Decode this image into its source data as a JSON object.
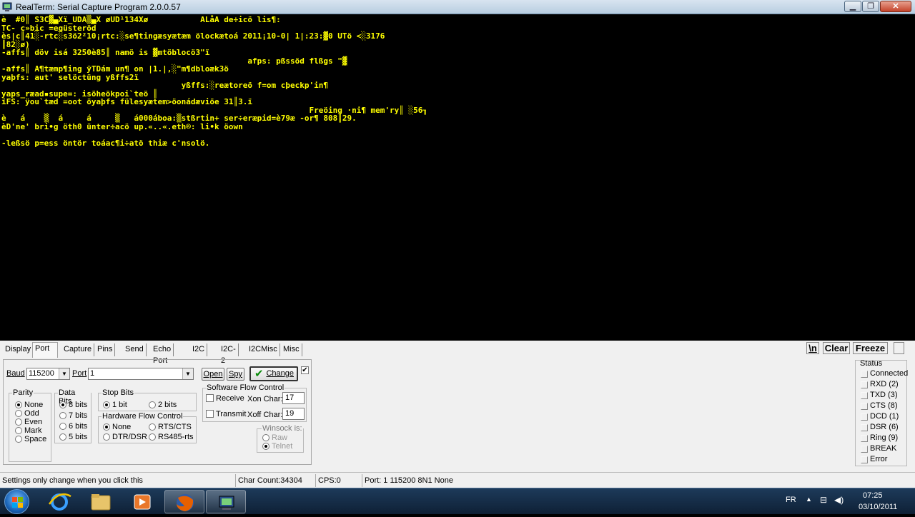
{
  "window": {
    "title": "RealTerm: Serial Capture Program 2.0.0.57"
  },
  "terminal": {
    "lines": [
      "è  #0║ S3C▓▄Xï_UDA▒▄X øUD¹134Xø           ALåA de÷icö lis¶:",
      "TC- c»bic =egüsteröd",
      "ès|c║41░-rtc░s3ö2²10¡rtc:░se¶tingæsyætæm ölockætoá 2011¡10-0| 1|:23:▓0 UTö <░3176",
      "║82░ø)",
      "-affs║ döv isá 3250è85║ namö is ▓mtöblocö3\"ï",
      "                                                    afps: pßssöd flßgs \"▓",
      "-affs║ A¶tæmp¶ing ÿTDám un¶ on |1.|,░\"m¶dbloæk3ö",
      "yaþfs: aut' selöctüng yßffs2ï",
      "                                      yßffs:░reætoreö f=om cþeckp'in¶",
      "yaps_ræad▪supe=: isöheökpoi`teö ║",
      "ïFS: ÿou`tæd =oot öyaþfs fülesyætem>öonádæviöe 31║3.ï",
      "                                                                 Freöing ·ni¶ mem'ry║ ░56╖",
      "è   á    ▒  á     á     ▒   á000áboa:▒stßrtin+ ser÷eræpid=è79æ -or¶ 808║29.",
      "èD'ne' bri•g öth0 ünter÷acö up.«..«.eth®: li•k öown",
      "",
      "-leßsö p=ess öntör toáac¶i÷atö thiæ c'nsolö."
    ]
  },
  "tabs": [
    "Display",
    "Port",
    "Capture",
    "Pins",
    "Send",
    "Echo Port",
    "I2C",
    "I2C-2",
    "I2CMisc",
    "Misc"
  ],
  "top_buttons": {
    "newline": "\\n",
    "clear": "Clear",
    "freeze": "Freeze"
  },
  "port": {
    "baud_label": "Baud",
    "baud_value": "115200",
    "port_label": "Port",
    "port_value": "1",
    "open": "Open",
    "spy": "Spy",
    "change": "Change",
    "parity": {
      "title": "Parity",
      "options": [
        "None",
        "Odd",
        "Even",
        "Mark",
        "Space"
      ],
      "selected": "None"
    },
    "data_bits": {
      "title": "Data Bits",
      "options": [
        "8 bits",
        "7 bits",
        "6 bits",
        "5 bits"
      ],
      "selected": "8 bits"
    },
    "stop_bits": {
      "title": "Stop Bits",
      "options": [
        "1 bit",
        "2 bits"
      ],
      "selected": "1 bit"
    },
    "hw_flow": {
      "title": "Hardware Flow Control",
      "options": [
        "None",
        "RTS/CTS",
        "DTR/DSR",
        "RS485-rts"
      ],
      "selected": "None"
    },
    "sw_flow": {
      "title": "Software Flow Control",
      "receive": "Receive",
      "transmit": "Transmit",
      "xon_label": "Xon Char:",
      "xon_value": "17",
      "xoff_label": "Xoff Char:",
      "xoff_value": "19"
    },
    "winsock": {
      "title": "Winsock is:",
      "options": [
        "Raw",
        "Telnet"
      ],
      "selected": "Telnet"
    }
  },
  "status": {
    "title": "Status",
    "items": [
      "Connected",
      "RXD (2)",
      "TXD (3)",
      "CTS (8)",
      "DCD (1)",
      "DSR (6)",
      "Ring (9)",
      "BREAK",
      "Error"
    ]
  },
  "statusbar": {
    "hint": "Settings only change when you click this",
    "char_count": "Char Count:34304",
    "cps": "CPS:0",
    "port_info": "Port: 1 115200 8N1 None"
  },
  "taskbar": {
    "lang": "FR",
    "time": "07:25",
    "date": "03/10/2011"
  },
  "colors": {
    "terminal_text": "#ffff00",
    "terminal_bg": "#000000"
  }
}
